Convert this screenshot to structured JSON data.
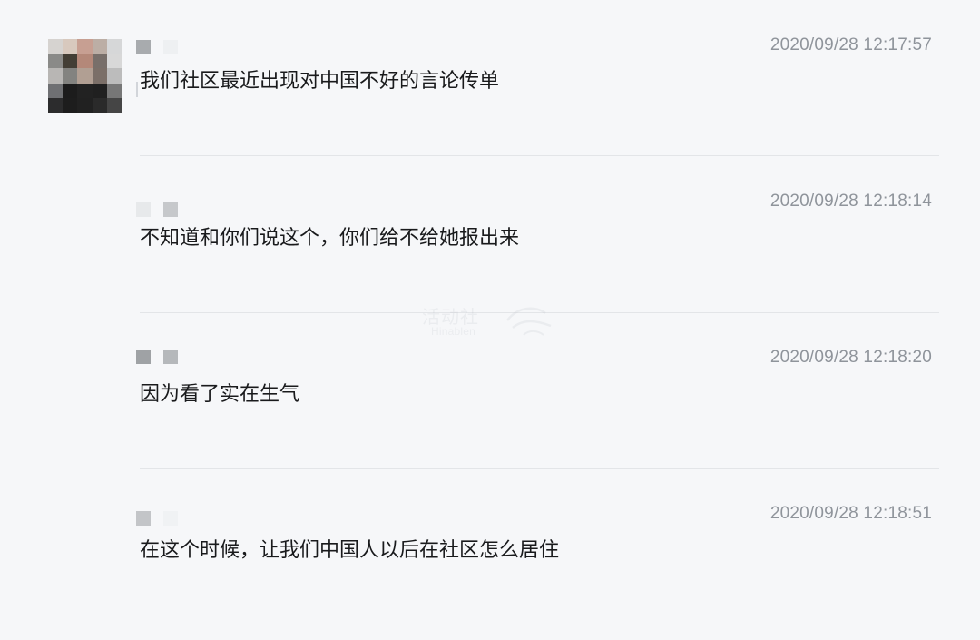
{
  "messages": [
    {
      "time": "2020/09/28 12:17:57",
      "text": "我们社区最近出现对中国不好的言论传单",
      "show_avatar": true,
      "avatar_colors": [
        "#d6d3d0",
        "#d8c9be",
        "#c79f92",
        "#bcaea5",
        "#d6d7d8",
        "#8a8a88",
        "#433e35",
        "#b48879",
        "#786f6a",
        "#d8d8d8",
        "#b8b6b4",
        "#838380",
        "#b19f93",
        "#7b6f68",
        "#bcbcbc",
        "#6f7073",
        "#1c1c1c",
        "#222222",
        "#202020",
        "#777777",
        "#2c2c2d",
        "#1d1d1d",
        "#212121",
        "#2a2a2a",
        "#454545"
      ]
    },
    {
      "time": "2020/09/28 12:18:14",
      "text": "不知道和你们说这个，你们给不给她报出来",
      "show_avatar": false
    },
    {
      "time": "2020/09/28 12:18:20",
      "text": "因为看了实在生气",
      "show_avatar": false
    },
    {
      "time": "2020/09/28 12:18:51",
      "text": "在这个时候，让我们中国人以后在社区怎么居住",
      "show_avatar": false
    }
  ],
  "watermark": {
    "title": "活动社",
    "subtitle": "Hinablen"
  }
}
